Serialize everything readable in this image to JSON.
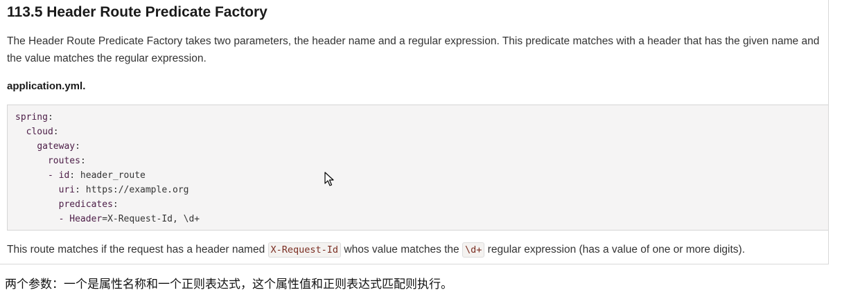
{
  "section": {
    "title": "113.5 Header Route Predicate Factory",
    "intro": "The Header Route Predicate Factory takes two parameters, the header name and a regular expression. This predicate matches with a header that has the given name and the value matches the regular expression.",
    "file_label": "application.yml."
  },
  "code": {
    "language": "yaml",
    "lines": [
      {
        "indent": "",
        "key": "spring",
        "sep": ":",
        "value": ""
      },
      {
        "indent": "  ",
        "key": "cloud",
        "sep": ":",
        "value": ""
      },
      {
        "indent": "    ",
        "key": "gateway",
        "sep": ":",
        "value": ""
      },
      {
        "indent": "      ",
        "key": "routes",
        "sep": ":",
        "value": ""
      },
      {
        "indent": "      ",
        "key": "- id",
        "sep": ":",
        "value": " header_route"
      },
      {
        "indent": "        ",
        "key": "uri",
        "sep": ":",
        "value": " https://example.org"
      },
      {
        "indent": "        ",
        "key": "predicates",
        "sep": ":",
        "value": ""
      },
      {
        "indent": "        ",
        "key": "- Header",
        "sep": "=",
        "value": "X-Request-Id, \\d+"
      }
    ]
  },
  "summary": {
    "text_before": "This route matches if the request has a header named ",
    "code_header": "X-Request-Id",
    "text_middle": " whos value matches the ",
    "code_regex": "\\d+",
    "text_after": " regular expression (has a value of one or more digits)."
  },
  "note": {
    "text": "两个参数：一个是属性名称和一个正则表达式，这个属性值和正则表达式匹配则执行。"
  },
  "icons": {
    "cursor": "mouse-pointer-icon"
  },
  "colors": {
    "yaml_key": "#4b1c46",
    "inline_code_text": "#7a2d21",
    "code_background": "#f5f4f4"
  }
}
